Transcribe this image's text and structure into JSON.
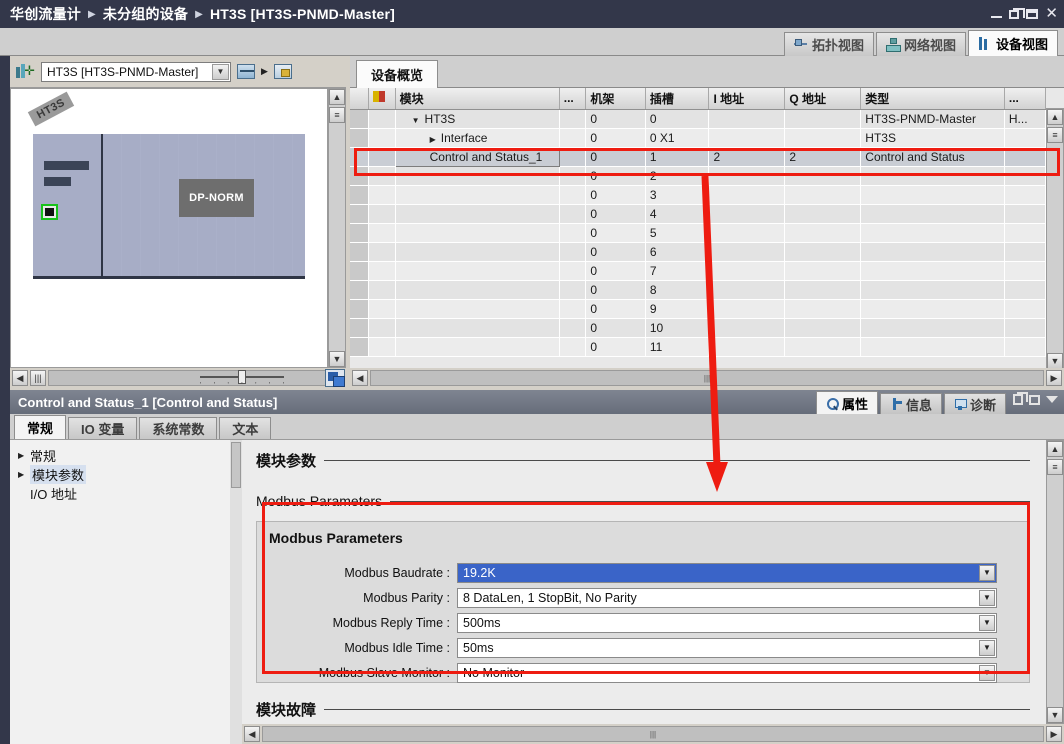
{
  "window": {
    "breadcrumb": [
      "华创流量计",
      "未分组的设备",
      "HT3S [HT3S-PNMD-Master]"
    ],
    "buttons": {
      "minimize": "minimize-button",
      "restore": "restore-button",
      "maximize": "maximize-button",
      "close": "close-button"
    }
  },
  "view_tabs": [
    {
      "label": "拓扑视图",
      "icon": "topology-icon",
      "active": false
    },
    {
      "label": "网络视图",
      "icon": "network-icon",
      "active": false
    },
    {
      "label": "设备视图",
      "icon": "device-icon",
      "active": true
    }
  ],
  "device_toolbar": {
    "select_icon": "device-select-icon",
    "combo_value": "HT3S [HT3S-PNMD-Master]",
    "combo_arrow": "▼",
    "tool2_icon": "fit-width-icon",
    "tool_tri": "▶",
    "tool3_icon": "module-lock-icon"
  },
  "device_graphic": {
    "rack_label": "HT3S",
    "module_label": "DP-NORM",
    "zoom_slider_value": "45"
  },
  "overview_tab": {
    "label": "设备概览"
  },
  "table": {
    "columns": [
      "",
      "",
      "模块",
      "...",
      "机架",
      "插槽",
      "I 地址",
      "Q 地址",
      "类型",
      "..."
    ],
    "warn_icon": "warning-filter-icon",
    "rows": [
      {
        "indent": 1,
        "arrow": "▼",
        "name": "HT3S",
        "dots": "",
        "rack": "0",
        "slot": "0",
        "i_addr": "",
        "q_addr": "",
        "type": "HT3S-PNMD-Master",
        "more": "H..."
      },
      {
        "indent": 2,
        "arrow": "▶",
        "name": "Interface",
        "dots": "",
        "rack": "0",
        "slot": "0 X1",
        "i_addr": "",
        "q_addr": "",
        "type": "HT3S",
        "more": ""
      },
      {
        "indent": 2,
        "arrow": "",
        "name": "Control and Status_1",
        "dots": "",
        "rack": "0",
        "slot": "1",
        "i_addr": "2",
        "q_addr": "2",
        "type": "Control and Status",
        "more": "",
        "selected": true
      },
      {
        "indent": 0,
        "arrow": "",
        "name": "",
        "dots": "",
        "rack": "0",
        "slot": "2",
        "i_addr": "",
        "q_addr": "",
        "type": "",
        "more": ""
      },
      {
        "indent": 0,
        "arrow": "",
        "name": "",
        "dots": "",
        "rack": "0",
        "slot": "3",
        "i_addr": "",
        "q_addr": "",
        "type": "",
        "more": ""
      },
      {
        "indent": 0,
        "arrow": "",
        "name": "",
        "dots": "",
        "rack": "0",
        "slot": "4",
        "i_addr": "",
        "q_addr": "",
        "type": "",
        "more": ""
      },
      {
        "indent": 0,
        "arrow": "",
        "name": "",
        "dots": "",
        "rack": "0",
        "slot": "5",
        "i_addr": "",
        "q_addr": "",
        "type": "",
        "more": ""
      },
      {
        "indent": 0,
        "arrow": "",
        "name": "",
        "dots": "",
        "rack": "0",
        "slot": "6",
        "i_addr": "",
        "q_addr": "",
        "type": "",
        "more": ""
      },
      {
        "indent": 0,
        "arrow": "",
        "name": "",
        "dots": "",
        "rack": "0",
        "slot": "7",
        "i_addr": "",
        "q_addr": "",
        "type": "",
        "more": ""
      },
      {
        "indent": 0,
        "arrow": "",
        "name": "",
        "dots": "",
        "rack": "0",
        "slot": "8",
        "i_addr": "",
        "q_addr": "",
        "type": "",
        "more": ""
      },
      {
        "indent": 0,
        "arrow": "",
        "name": "",
        "dots": "",
        "rack": "0",
        "slot": "9",
        "i_addr": "",
        "q_addr": "",
        "type": "",
        "more": ""
      },
      {
        "indent": 0,
        "arrow": "",
        "name": "",
        "dots": "",
        "rack": "0",
        "slot": "10",
        "i_addr": "",
        "q_addr": "",
        "type": "",
        "more": ""
      },
      {
        "indent": 0,
        "arrow": "",
        "name": "",
        "dots": "",
        "rack": "0",
        "slot": "11",
        "i_addr": "",
        "q_addr": "",
        "type": "",
        "more": ""
      }
    ]
  },
  "properties": {
    "title": "Control and Status_1 [Control and Status]",
    "tabs": [
      {
        "label": "属性",
        "icon": "properties-icon",
        "active": true
      },
      {
        "label": "信息",
        "icon": "info-icon",
        "active": false
      },
      {
        "label": "诊断",
        "icon": "diagnostics-icon",
        "active": false
      }
    ],
    "subtabs": [
      {
        "label": "常规",
        "active": true
      },
      {
        "label": "IO 变量",
        "active": false
      },
      {
        "label": "系统常数",
        "active": false
      },
      {
        "label": "文本",
        "active": false
      }
    ],
    "nav": [
      {
        "label": "常规",
        "arrow": "▶",
        "selected": false,
        "child": false
      },
      {
        "label": "模块参数",
        "arrow": "▶",
        "selected": true,
        "child": false
      },
      {
        "label": "I/O 地址",
        "arrow": "",
        "selected": false,
        "child": true
      }
    ],
    "section_title": "模块参数",
    "subsection_title": "Modbus Parameters",
    "group_title": "Modbus Parameters",
    "fields": [
      {
        "label": "Modbus Baudrate :",
        "value": "19.2K",
        "selected": true
      },
      {
        "label": "Modbus Parity :",
        "value": "8 DataLen, 1 StopBit, No Parity",
        "selected": false
      },
      {
        "label": "Modbus Reply Time :",
        "value": "500ms",
        "selected": false
      },
      {
        "label": "Modbus Idle Time :",
        "value": "50ms",
        "selected": false
      },
      {
        "label": "Modbus Slave Monitor :",
        "value": "No Monitor",
        "selected": false
      }
    ],
    "fault_section_title": "模块故障"
  },
  "annotations": {
    "highlight_color": "#ee1c11",
    "row_box": "Control and Status_1 row highlight",
    "param_box": "Modbus Parameters group highlight",
    "arrow": "arrow from selected module row to Modbus Parameters"
  },
  "colors": {
    "title_bar": "#33374a",
    "selection_blue": "#3a64c8",
    "annotation_red": "#ee1c11"
  }
}
